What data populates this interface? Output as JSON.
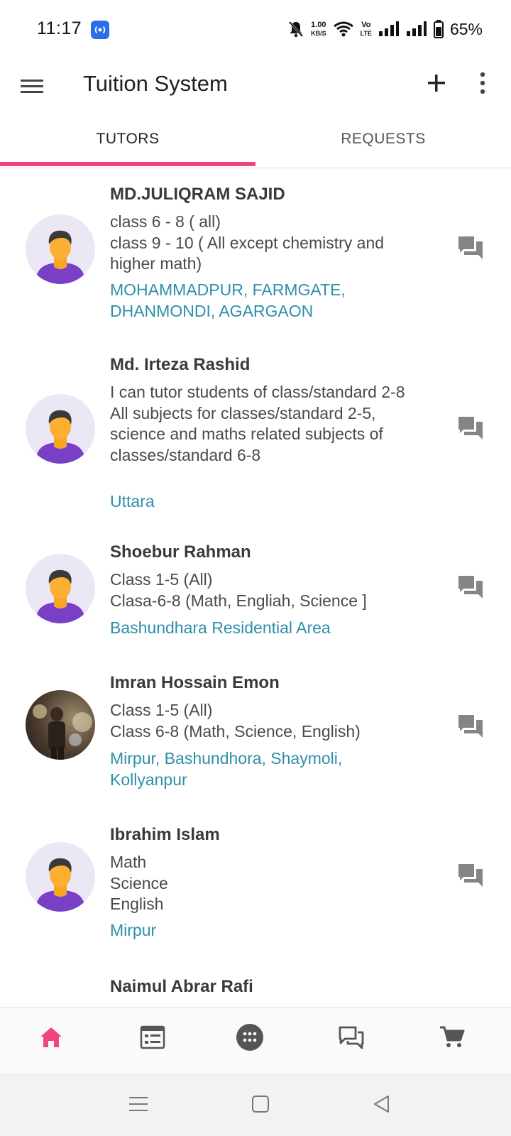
{
  "status_bar": {
    "time": "11:17",
    "net_speed_value": "1.00",
    "net_speed_unit": "KB/S",
    "volte_label_top": "Vo",
    "volte_label_bottom": "LTE",
    "battery": "65%"
  },
  "app_bar": {
    "title": "Tuition System"
  },
  "tabs": [
    {
      "label": "TUTORS",
      "active": true
    },
    {
      "label": "REQUESTS",
      "active": false
    }
  ],
  "accent_color": "#f0457a",
  "area_color": "#2e8fa8",
  "tutors": [
    {
      "name": "MD.JULIQRAM SAJID",
      "description": "class 6 - 8 ( all)\nclass 9 - 10 ( All except chemistry and higher math)",
      "areas": "MOHAMMADPUR,  FARMGATE,  DHANMONDI,  AGARGAON",
      "avatar": "default-avatar"
    },
    {
      "name": "Md. Irteza Rashid",
      "description": "I can tutor students of class/standard 2-8\nAll subjects for classes/standard 2-5, science and maths related subjects of classes/standard 6-8",
      "areas": "Uttara",
      "avatar": "default-avatar"
    },
    {
      "name": "Shoebur Rahman",
      "description": "Class 1-5 (All)\nClasa-6-8 (Math, Engliah, Science ]",
      "areas": "Bashundhara Residential Area",
      "avatar": "default-avatar"
    },
    {
      "name": "Imran Hossain Emon",
      "description": "Class 1-5 (All)\nClass 6-8 (Math, Science, English)",
      "areas": "Mirpur, Bashundhora, Shaymoli, Kollyanpur",
      "avatar": "photo"
    },
    {
      "name": "Ibrahim Islam",
      "description": "Math\nScience\nEnglish",
      "areas": "Mirpur",
      "avatar": "default-avatar"
    },
    {
      "name": "Naimul Abrar Rafi",
      "description": "",
      "areas": "",
      "avatar": "default-avatar"
    }
  ],
  "bottom_nav": [
    {
      "icon": "home-icon",
      "active": true
    },
    {
      "icon": "list-icon",
      "active": false
    },
    {
      "icon": "apps-icon",
      "active": false
    },
    {
      "icon": "chat-bubbles-icon",
      "active": false
    },
    {
      "icon": "cart-icon",
      "active": false
    }
  ]
}
